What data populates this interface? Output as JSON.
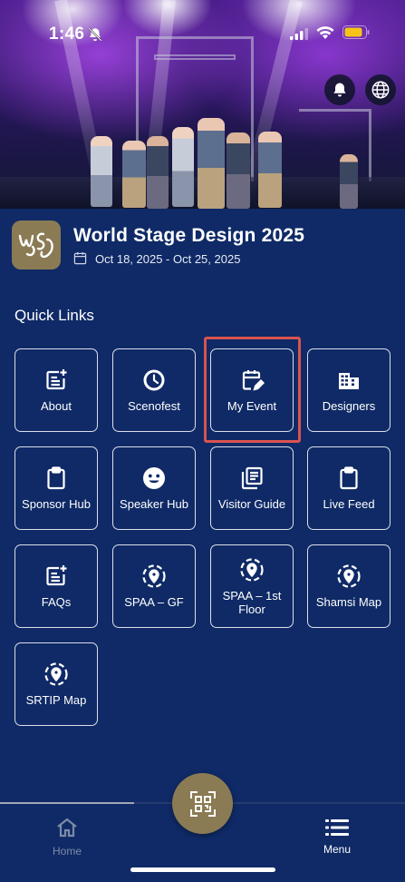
{
  "status_bar": {
    "time": "1:46"
  },
  "event": {
    "title": "World Stage Design 2025",
    "dates": "Oct 18, 2025 - Oct 25, 2025",
    "logo_text": "wsd"
  },
  "quick_links": {
    "title": "Quick Links",
    "items": [
      {
        "label": "About",
        "icon": "note-add-icon"
      },
      {
        "label": "Scenofest",
        "icon": "clock-icon"
      },
      {
        "label": "My Event",
        "icon": "calendar-edit-icon"
      },
      {
        "label": "Designers",
        "icon": "building-icon"
      },
      {
        "label": "Sponsor Hub",
        "icon": "clipboard-icon"
      },
      {
        "label": "Speaker Hub",
        "icon": "face-icon"
      },
      {
        "label": "Visitor Guide",
        "icon": "document-stack-icon"
      },
      {
        "label": "Live Feed",
        "icon": "clipboard-icon"
      },
      {
        "label": "FAQs",
        "icon": "note-add-icon"
      },
      {
        "label": "SPAA – GF",
        "icon": "map-pin-icon"
      },
      {
        "label": "SPAA – 1st Floor",
        "icon": "map-pin-icon"
      },
      {
        "label": "Shamsi Map",
        "icon": "map-pin-icon"
      },
      {
        "label": "SRTIP Map",
        "icon": "map-pin-icon"
      }
    ]
  },
  "bottom_nav": {
    "home_label": "Home",
    "menu_label": "Menu"
  },
  "colors": {
    "background": "#0f2a66",
    "accent": "#8a7b54",
    "highlight": "#d9534f"
  }
}
